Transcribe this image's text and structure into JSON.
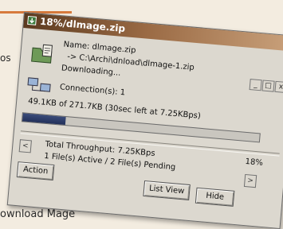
{
  "page": {
    "fragment_top": "os",
    "fragment_bottom": "ownload Mage",
    "accent_color": "#d77a3c"
  },
  "window": {
    "title": "18%/dlmage.zip",
    "controls": {
      "minimize": "_",
      "restore": "□",
      "close": "x"
    },
    "name_line": "Name: dlmage.zip",
    "dest_line": "-> C:\\Archi\\dnload\\dlmage-1.zip",
    "status": "Downloading...",
    "connections": "Connection(s): 1",
    "progress_text": "49.1KB of 271.7KB  (30sec left at 7.25KBps)",
    "progress_fraction": 0.18,
    "throughput": "Total Throughput: 7.25KBps",
    "percent": "18%",
    "files_status": "1 File(s) Active / 2 File(s) Pending",
    "left_arrow": "<",
    "right_arrow": ">",
    "buttons": {
      "action": "Action",
      "list_view": "List View",
      "hide": "Hide"
    },
    "icons": {
      "title_icon": "download-arrow-icon",
      "file_icon": "folder-file-icon",
      "network_icon": "network-computers-icon"
    }
  }
}
